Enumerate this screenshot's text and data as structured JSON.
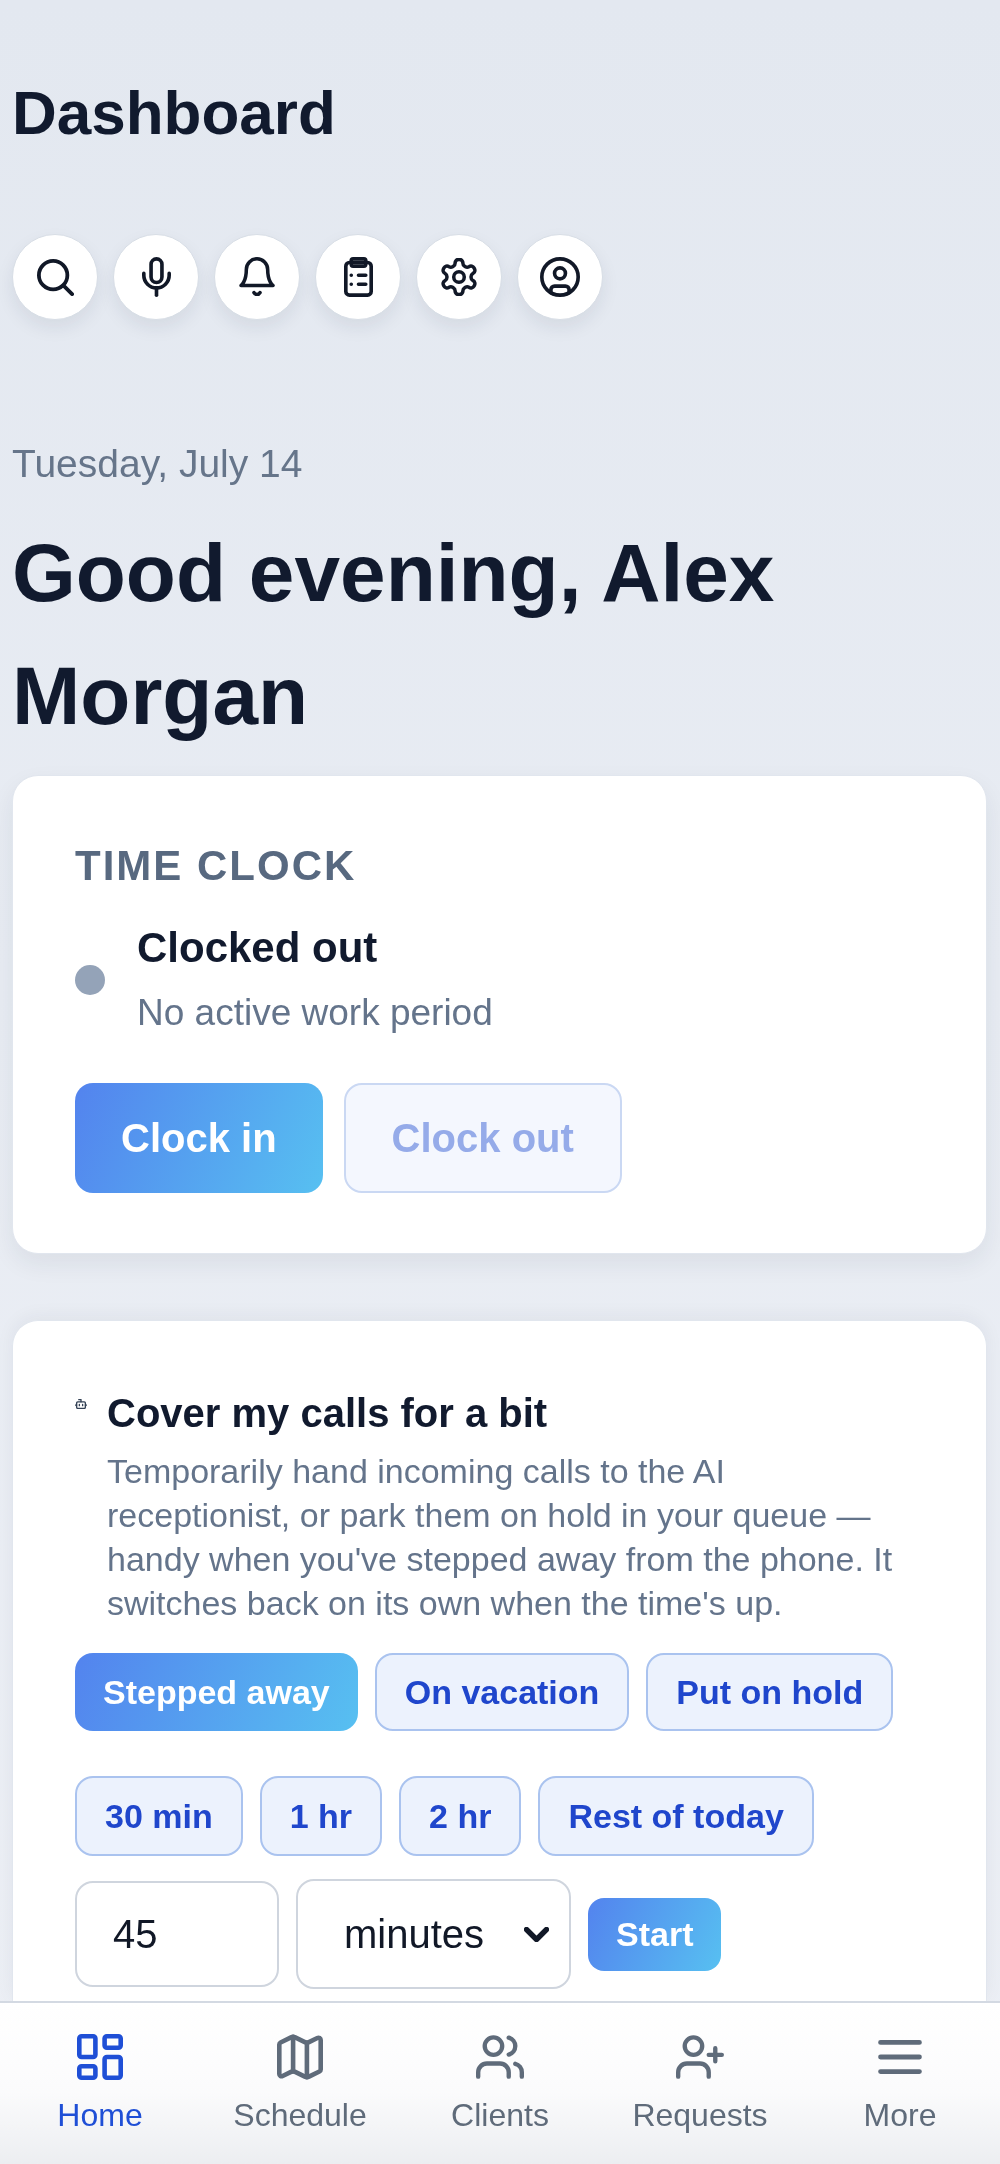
{
  "header": {
    "title": "Dashboard"
  },
  "greeting": {
    "date": "Tuesday, July 14",
    "text": "Good evening, Alex Morgan"
  },
  "time_clock": {
    "heading": "TIME CLOCK",
    "clocked_in": false,
    "status": "Clocked out",
    "detail": "No active work period",
    "buttons": [
      {
        "label": "Clock in",
        "disabled": false
      },
      {
        "label": "Clock out",
        "disabled": true
      }
    ]
  },
  "call_cover": {
    "title": "Cover my calls for a bit",
    "description": "Temporarily hand incoming calls to the AI receptionist, or park them on hold in your queue — handy when you've stepped away from the phone. It switches back on its own when the time's up.",
    "modes": [
      {
        "label": "Stepped away",
        "selected": true
      },
      {
        "label": "On vacation",
        "selected": false
      },
      {
        "label": "Put on hold",
        "selected": false
      }
    ],
    "durations": [
      {
        "label": "30 min",
        "selected": false
      },
      {
        "label": "1 hr",
        "selected": false
      },
      {
        "label": "2 hr",
        "selected": false
      },
      {
        "label": "Rest of today",
        "selected": false
      }
    ],
    "custom": {
      "value": "45",
      "unit": "minutes",
      "button": "Start"
    }
  },
  "bottom_nav": [
    {
      "label": "Home",
      "selected": true
    },
    {
      "label": "Schedule",
      "selected": false
    },
    {
      "label": "Clients",
      "selected": false
    },
    {
      "label": "Requests",
      "selected": false
    },
    {
      "label": "More",
      "selected": false
    }
  ]
}
